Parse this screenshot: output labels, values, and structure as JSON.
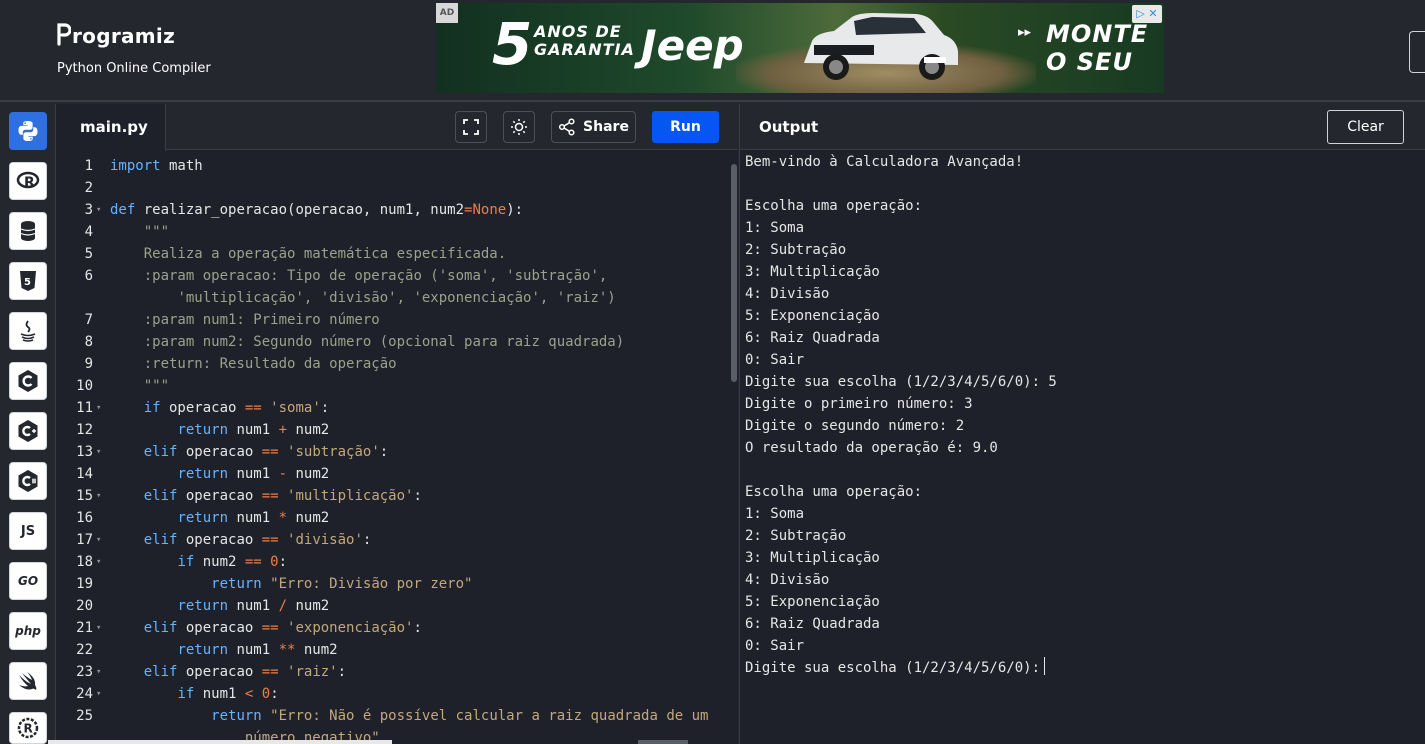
{
  "header": {
    "logo_text": "rogramiz",
    "subtitle": "Python Online Compiler"
  },
  "ad": {
    "tag": "AD",
    "number": "5",
    "tagline_line1": "ANOS DE",
    "tagline_line2": "GARANTIA",
    "brand": "Jeep",
    "cta_line1": "MONTE",
    "cta_line2": "O SEU"
  },
  "sidebar": {
    "items": [
      {
        "name": "python",
        "label": ""
      },
      {
        "name": "r",
        "label": "R"
      },
      {
        "name": "sql",
        "label": ""
      },
      {
        "name": "html",
        "label": "5"
      },
      {
        "name": "java",
        "label": ""
      },
      {
        "name": "c",
        "label": "C"
      },
      {
        "name": "cpp",
        "label": "C+"
      },
      {
        "name": "csharp",
        "label": "C#"
      },
      {
        "name": "js",
        "label": "JS"
      },
      {
        "name": "go",
        "label": "GO"
      },
      {
        "name": "php",
        "label": "php"
      },
      {
        "name": "swift",
        "label": ""
      },
      {
        "name": "rust",
        "label": "R"
      }
    ]
  },
  "editor": {
    "file_tab": "main.py",
    "share_label": "Share",
    "run_label": "Run",
    "lines": [
      {
        "n": "1",
        "fold": false,
        "indent": 0,
        "parts": [
          [
            "kw",
            "import"
          ],
          [
            "t",
            " math"
          ]
        ]
      },
      {
        "n": "2",
        "fold": false,
        "indent": 0,
        "parts": []
      },
      {
        "n": "3",
        "fold": true,
        "indent": 0,
        "parts": [
          [
            "kw",
            "def"
          ],
          [
            "t",
            " realizar_operacao(operacao, num1, num2"
          ],
          [
            "op",
            "="
          ],
          [
            "num",
            "None"
          ],
          [
            "t",
            "):"
          ]
        ]
      },
      {
        "n": "4",
        "fold": false,
        "indent": 4,
        "parts": [
          [
            "doc",
            "\"\"\""
          ]
        ]
      },
      {
        "n": "5",
        "fold": false,
        "indent": 4,
        "parts": [
          [
            "doc",
            "Realiza a operação matemática especificada."
          ]
        ]
      },
      {
        "n": "6",
        "fold": false,
        "indent": 4,
        "parts": [
          [
            "doc",
            ":param operacao: Tipo de operação ('soma', 'subtração',"
          ]
        ]
      },
      {
        "n": "",
        "fold": false,
        "indent": 8,
        "parts": [
          [
            "doc",
            "'multiplicação', 'divisão', 'exponenciação', 'raiz')"
          ]
        ]
      },
      {
        "n": "7",
        "fold": false,
        "indent": 4,
        "parts": [
          [
            "doc",
            ":param num1: Primeiro número"
          ]
        ]
      },
      {
        "n": "8",
        "fold": false,
        "indent": 4,
        "parts": [
          [
            "doc",
            ":param num2: Segundo número (opcional para raiz quadrada)"
          ]
        ]
      },
      {
        "n": "9",
        "fold": false,
        "indent": 4,
        "parts": [
          [
            "doc",
            ":return: Resultado da operação"
          ]
        ]
      },
      {
        "n": "10",
        "fold": false,
        "indent": 4,
        "parts": [
          [
            "doc",
            "\"\"\""
          ]
        ]
      },
      {
        "n": "11",
        "fold": true,
        "indent": 4,
        "parts": [
          [
            "kw",
            "if"
          ],
          [
            "t",
            " operacao "
          ],
          [
            "op",
            "=="
          ],
          [
            "t",
            " "
          ],
          [
            "str",
            "'soma'"
          ],
          [
            "t",
            ":"
          ]
        ]
      },
      {
        "n": "12",
        "fold": false,
        "indent": 8,
        "parts": [
          [
            "kw",
            "return"
          ],
          [
            "t",
            " num1 "
          ],
          [
            "op",
            "+"
          ],
          [
            "t",
            " num2"
          ]
        ]
      },
      {
        "n": "13",
        "fold": true,
        "indent": 4,
        "parts": [
          [
            "kw",
            "elif"
          ],
          [
            "t",
            " operacao "
          ],
          [
            "op",
            "=="
          ],
          [
            "t",
            " "
          ],
          [
            "str",
            "'subtração'"
          ],
          [
            "t",
            ":"
          ]
        ]
      },
      {
        "n": "14",
        "fold": false,
        "indent": 8,
        "parts": [
          [
            "kw",
            "return"
          ],
          [
            "t",
            " num1 "
          ],
          [
            "op",
            "-"
          ],
          [
            "t",
            " num2"
          ]
        ]
      },
      {
        "n": "15",
        "fold": true,
        "indent": 4,
        "parts": [
          [
            "kw",
            "elif"
          ],
          [
            "t",
            " operacao "
          ],
          [
            "op",
            "=="
          ],
          [
            "t",
            " "
          ],
          [
            "str",
            "'multiplicação'"
          ],
          [
            "t",
            ":"
          ]
        ]
      },
      {
        "n": "16",
        "fold": false,
        "indent": 8,
        "parts": [
          [
            "kw",
            "return"
          ],
          [
            "t",
            " num1 "
          ],
          [
            "op",
            "*"
          ],
          [
            "t",
            " num2"
          ]
        ]
      },
      {
        "n": "17",
        "fold": true,
        "indent": 4,
        "parts": [
          [
            "kw",
            "elif"
          ],
          [
            "t",
            " operacao "
          ],
          [
            "op",
            "=="
          ],
          [
            "t",
            " "
          ],
          [
            "str",
            "'divisão'"
          ],
          [
            "t",
            ":"
          ]
        ]
      },
      {
        "n": "18",
        "fold": true,
        "indent": 8,
        "parts": [
          [
            "kw",
            "if"
          ],
          [
            "t",
            " num2 "
          ],
          [
            "op",
            "=="
          ],
          [
            "t",
            " "
          ],
          [
            "num",
            "0"
          ],
          [
            "t",
            ":"
          ]
        ]
      },
      {
        "n": "19",
        "fold": false,
        "indent": 12,
        "parts": [
          [
            "kw",
            "return"
          ],
          [
            "t",
            " "
          ],
          [
            "str",
            "\"Erro: Divisão por zero\""
          ]
        ]
      },
      {
        "n": "20",
        "fold": false,
        "indent": 8,
        "parts": [
          [
            "kw",
            "return"
          ],
          [
            "t",
            " num1 "
          ],
          [
            "op",
            "/"
          ],
          [
            "t",
            " num2"
          ]
        ]
      },
      {
        "n": "21",
        "fold": true,
        "indent": 4,
        "parts": [
          [
            "kw",
            "elif"
          ],
          [
            "t",
            " operacao "
          ],
          [
            "op",
            "=="
          ],
          [
            "t",
            " "
          ],
          [
            "str",
            "'exponenciação'"
          ],
          [
            "t",
            ":"
          ]
        ]
      },
      {
        "n": "22",
        "fold": false,
        "indent": 8,
        "parts": [
          [
            "kw",
            "return"
          ],
          [
            "t",
            " num1 "
          ],
          [
            "op",
            "**"
          ],
          [
            "t",
            " num2"
          ]
        ]
      },
      {
        "n": "23",
        "fold": true,
        "indent": 4,
        "parts": [
          [
            "kw",
            "elif"
          ],
          [
            "t",
            " operacao "
          ],
          [
            "op",
            "=="
          ],
          [
            "t",
            " "
          ],
          [
            "str",
            "'raiz'"
          ],
          [
            "t",
            ":"
          ]
        ]
      },
      {
        "n": "24",
        "fold": true,
        "indent": 8,
        "parts": [
          [
            "kw",
            "if"
          ],
          [
            "t",
            " num1 "
          ],
          [
            "op",
            "<"
          ],
          [
            "t",
            " "
          ],
          [
            "num",
            "0"
          ],
          [
            "t",
            ":"
          ]
        ]
      },
      {
        "n": "25",
        "fold": false,
        "indent": 12,
        "parts": [
          [
            "kw",
            "return"
          ],
          [
            "t",
            " "
          ],
          [
            "str",
            "\"Erro: Não é possível calcular a raiz quadrada de um"
          ]
        ]
      },
      {
        "n": "",
        "fold": false,
        "indent": 16,
        "parts": [
          [
            "str",
            "número negativo\""
          ]
        ]
      }
    ]
  },
  "output": {
    "title": "Output",
    "clear_label": "Clear",
    "lines": [
      "Bem-vindo à Calculadora Avançada!",
      "",
      "Escolha uma operação:",
      "1: Soma",
      "2: Subtração",
      "3: Multiplicação",
      "4: Divisão",
      "5: Exponenciação",
      "6: Raiz Quadrada",
      "0: Sair",
      "Digite sua escolha (1/2/3/4/5/6/0): 5",
      "Digite o primeiro número: 3",
      "Digite o segundo número: 2",
      "O resultado da operação é: 9.0",
      "",
      "Escolha uma operação:",
      "1: Soma",
      "2: Subtração",
      "3: Multiplicação",
      "4: Divisão",
      "5: Exponenciação",
      "6: Raiz Quadrada",
      "0: Sair",
      "Digite sua escolha (1/2/3/4/5/6/0):"
    ]
  }
}
